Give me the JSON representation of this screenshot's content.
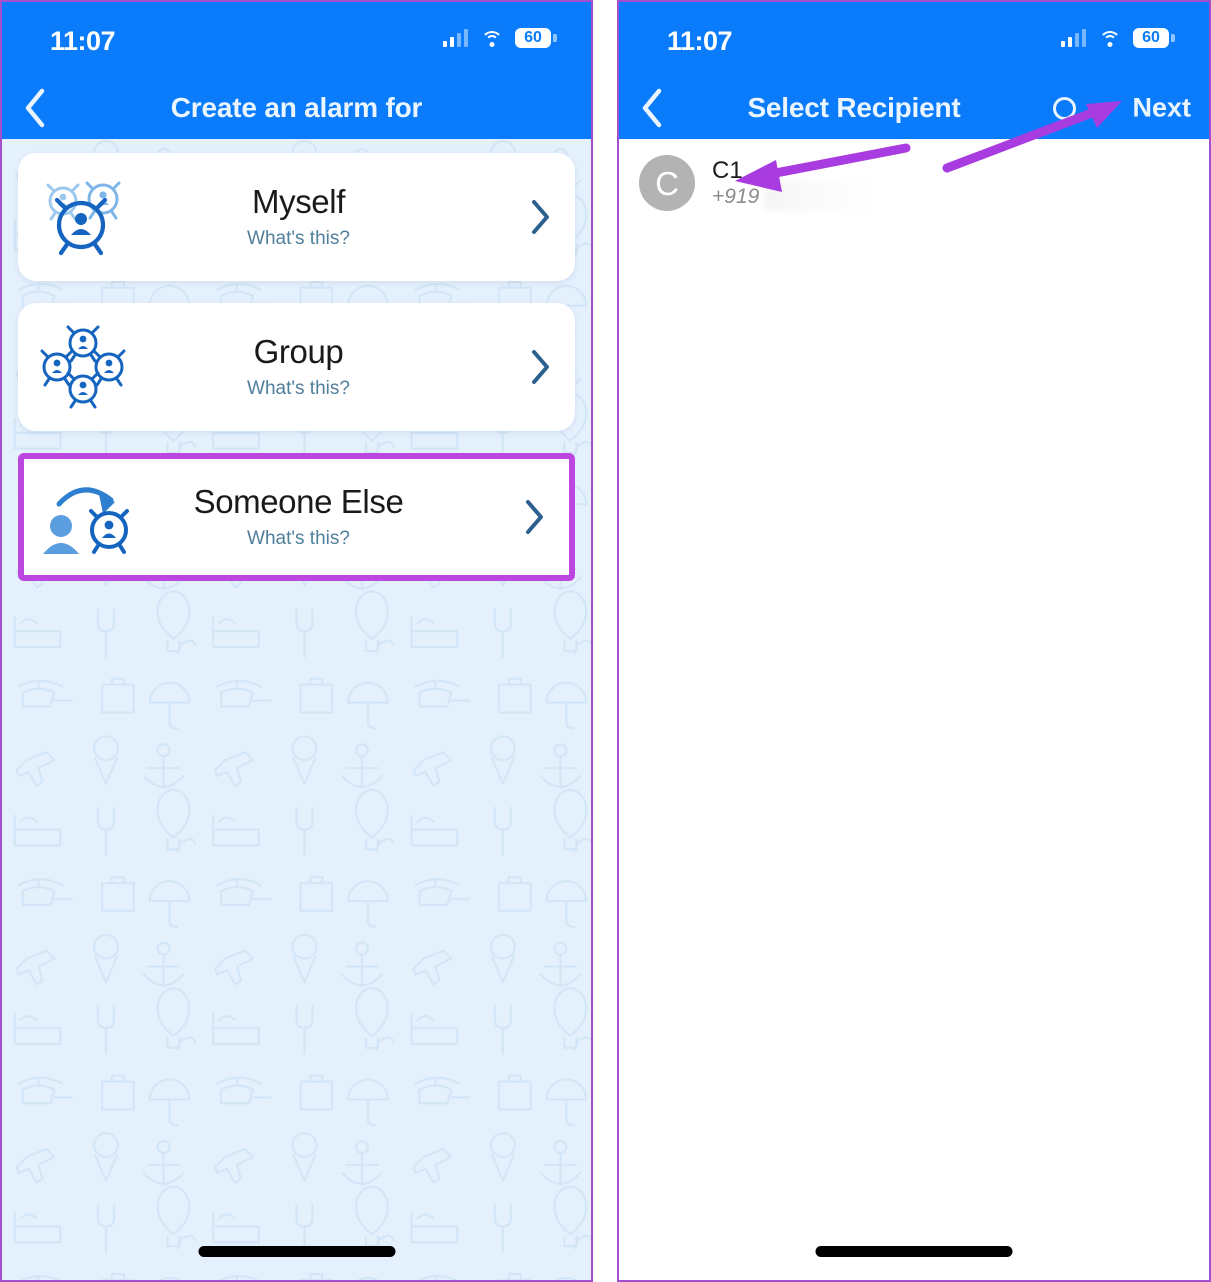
{
  "theme": {
    "header_blue": "#0a7cfb",
    "page_background": "#e4f0fc",
    "card_white": "#ffffff",
    "highlight_purple": "#bb46e0",
    "annotation_purple": "#a93ce0",
    "link_blue": "#4f7f9b",
    "chevron_blue": "#2b5f8e",
    "avatar_gray": "#b3b3b3"
  },
  "left_screen": {
    "status_bar": {
      "time": "11:07",
      "battery_level": "60",
      "signal_icon": "cellular-bars-icon",
      "wifi_icon": "wifi-icon",
      "battery_icon": "battery-icon"
    },
    "nav": {
      "back_icon": "back-chevron-icon",
      "title": "Create an alarm for"
    },
    "options": [
      {
        "title": "Myself",
        "subtitle": "What's this?",
        "icon": "alarm-clock-person-icon",
        "chevron": "chevron-right-icon",
        "highlighted": false
      },
      {
        "title": "Group",
        "subtitle": "What's this?",
        "icon": "group-alarm-clocks-icon",
        "chevron": "chevron-right-icon",
        "highlighted": false
      },
      {
        "title": "Someone Else",
        "subtitle": "What's this?",
        "icon": "person-arrow-alarm-icon",
        "chevron": "chevron-right-icon",
        "highlighted": true
      }
    ],
    "home_indicator": "home-indicator-bar"
  },
  "right_screen": {
    "status_bar": {
      "time": "11:07",
      "battery_level": "60",
      "signal_icon": "cellular-bars-icon",
      "wifi_icon": "wifi-icon",
      "battery_icon": "battery-icon"
    },
    "nav": {
      "back_icon": "back-chevron-icon",
      "title": "Select Recipient",
      "search_icon": "search-icon",
      "next_label": "Next"
    },
    "contacts": [
      {
        "avatar_initial": "C",
        "name": "C1",
        "phone": "+919"
      }
    ],
    "home_indicator": "home-indicator-bar"
  },
  "annotations": [
    {
      "name": "arrow-to-next-button",
      "direction": "up-right"
    },
    {
      "name": "arrow-to-contact-c1",
      "direction": "left"
    }
  ]
}
